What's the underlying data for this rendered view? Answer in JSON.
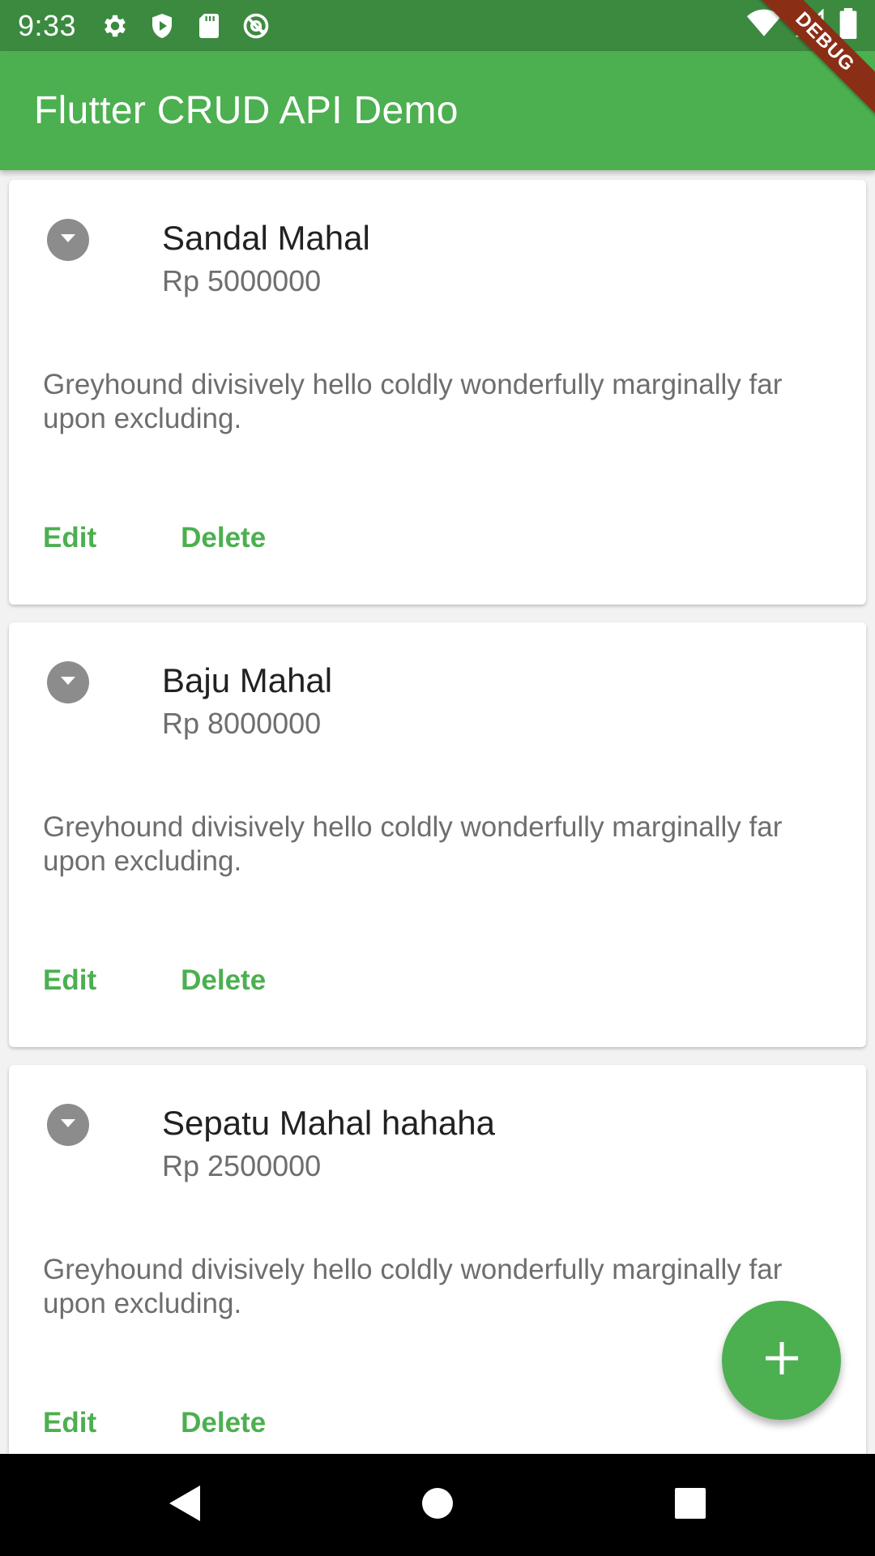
{
  "status_bar": {
    "time": "9:33",
    "left_icons": [
      "gear-icon",
      "shield-play-icon",
      "sd-card-icon",
      "at-sign-icon"
    ],
    "right_icons": [
      "wifi-icon",
      "cell-signal-icon",
      "battery-icon"
    ]
  },
  "app_bar": {
    "title": "Flutter CRUD API Demo",
    "color": "#4caf50"
  },
  "debug_banner": {
    "label": "DEBUG"
  },
  "products": [
    {
      "name": "Sandal Mahal",
      "price": "Rp 5000000",
      "description": "Greyhound divisively hello coldly wonderfully marginally far upon excluding.",
      "edit_label": "Edit",
      "delete_label": "Delete"
    },
    {
      "name": "Baju Mahal",
      "price": "Rp 8000000",
      "description": "Greyhound divisively hello coldly wonderfully marginally far upon excluding.",
      "edit_label": "Edit",
      "delete_label": "Delete"
    },
    {
      "name": "Sepatu Mahal hahaha",
      "price": "Rp 2500000",
      "description": "Greyhound divisively hello coldly wonderfully marginally far upon excluding.",
      "edit_label": "Edit",
      "delete_label": "Delete"
    }
  ],
  "fab": {
    "icon": "plus-icon"
  },
  "nav_bar": {
    "icons": [
      "back-icon",
      "home-icon",
      "recents-icon"
    ]
  }
}
